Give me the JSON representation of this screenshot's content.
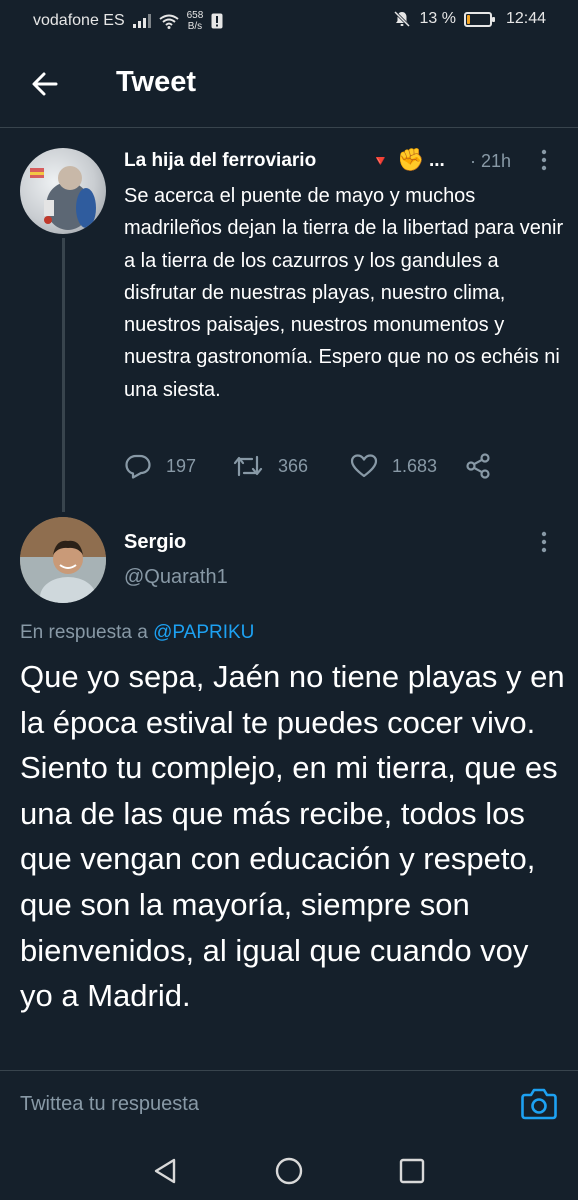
{
  "status_bar": {
    "carrier": "vodafone ES",
    "net_speed_value": "658",
    "net_speed_unit": "B/s",
    "battery_percent": "13 %",
    "battery_level": 0.13,
    "time": "12:44"
  },
  "header": {
    "title": "Tweet"
  },
  "parent_tweet": {
    "author_name": "La hija del ferroviario",
    "badge": "🔻",
    "emoji": "✊",
    "ellipsis": "...",
    "time": "· 21h",
    "text": "Se acerca el puente de mayo y muchos madrileños dejan la tierra de la libertad para venir a la tierra de los cazurros y los gandules a disfrutar de nuestras playas, nuestro clima, nuestros paisajes, nuestros monumentos y nuestra gastronomía. Espero que no os echéis ni una siesta.",
    "replies": "197",
    "retweets": "366",
    "likes": "1.683"
  },
  "main_tweet": {
    "author_name": "Sergio",
    "handle": "@Quarath1",
    "reply_prefix": "En respuesta a",
    "reply_target": "@PAPRIKU",
    "text": "Que yo sepa, Jaén no tiene playas y en la época estival te puedes cocer vivo. Siento tu complejo, en mi tierra, que es una de las que más recibe, todos los que vengan con educación y respeto, que son la mayoría, siempre son bienvenidos, al igual que cuando voy yo a Madrid."
  },
  "composer": {
    "placeholder": "Twittea tu respuesta"
  },
  "colors": {
    "background": "#15202b",
    "secondary_text": "#8899a6",
    "accent": "#1da1f2",
    "divider": "#38444d"
  }
}
